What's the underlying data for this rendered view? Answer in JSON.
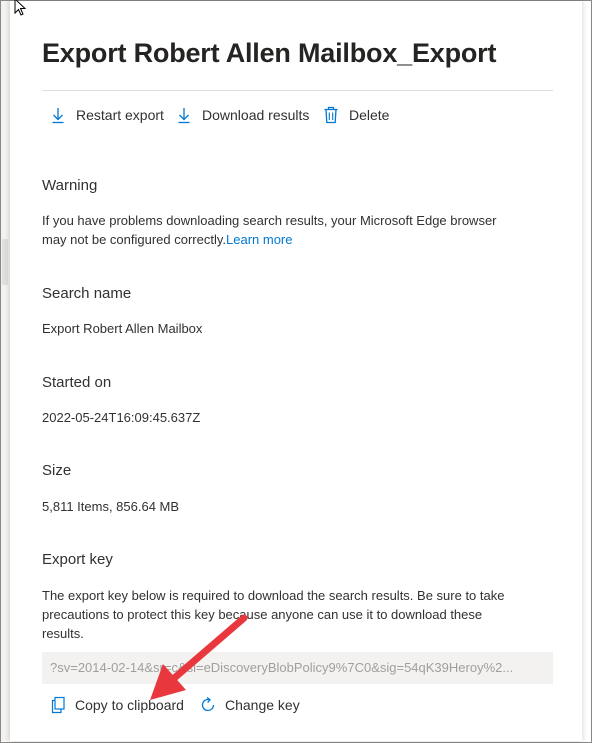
{
  "panel": {
    "title": "Export Robert Allen Mailbox_Export"
  },
  "toolbar": {
    "restart_label": "Restart export",
    "download_label": "Download results",
    "delete_label": "Delete"
  },
  "warning": {
    "heading": "Warning",
    "line1": "If you have problems downloading search results, your Microsoft Edge browser",
    "line2": "may not be configured correctly.",
    "link": "Learn more"
  },
  "search_name": {
    "heading": "Search name",
    "value": "Export Robert Allen Mailbox"
  },
  "started_on": {
    "heading": "Started on",
    "value": "2022-05-24T16:09:45.637Z"
  },
  "size": {
    "heading": "Size",
    "value": "5,811 Items, 856.64 MB"
  },
  "export_key": {
    "heading": "Export key",
    "line1": "The export key below is required to download the search results. Be sure to take",
    "line2": "precautions to protect this key because anyone can use it to download these",
    "line3": "results.",
    "key_value": "?sv=2014-02-14&sr=c&si=eDiscoveryBlobPolicy9%7C0&sig=54qK39Heroy%2...",
    "copy_label": "Copy to clipboard",
    "change_label": "Change key"
  },
  "colors": {
    "link": "#0078d4",
    "icon": "#0078d4",
    "annotation_arrow": "#e8383d",
    "field_bg": "#f3f2f1"
  },
  "icons": {
    "restart": "download-arrow-icon",
    "download": "download-arrow-icon",
    "delete": "trash-icon",
    "copy": "copy-icon",
    "change": "refresh-icon",
    "cursor": "mouse-pointer-icon"
  }
}
